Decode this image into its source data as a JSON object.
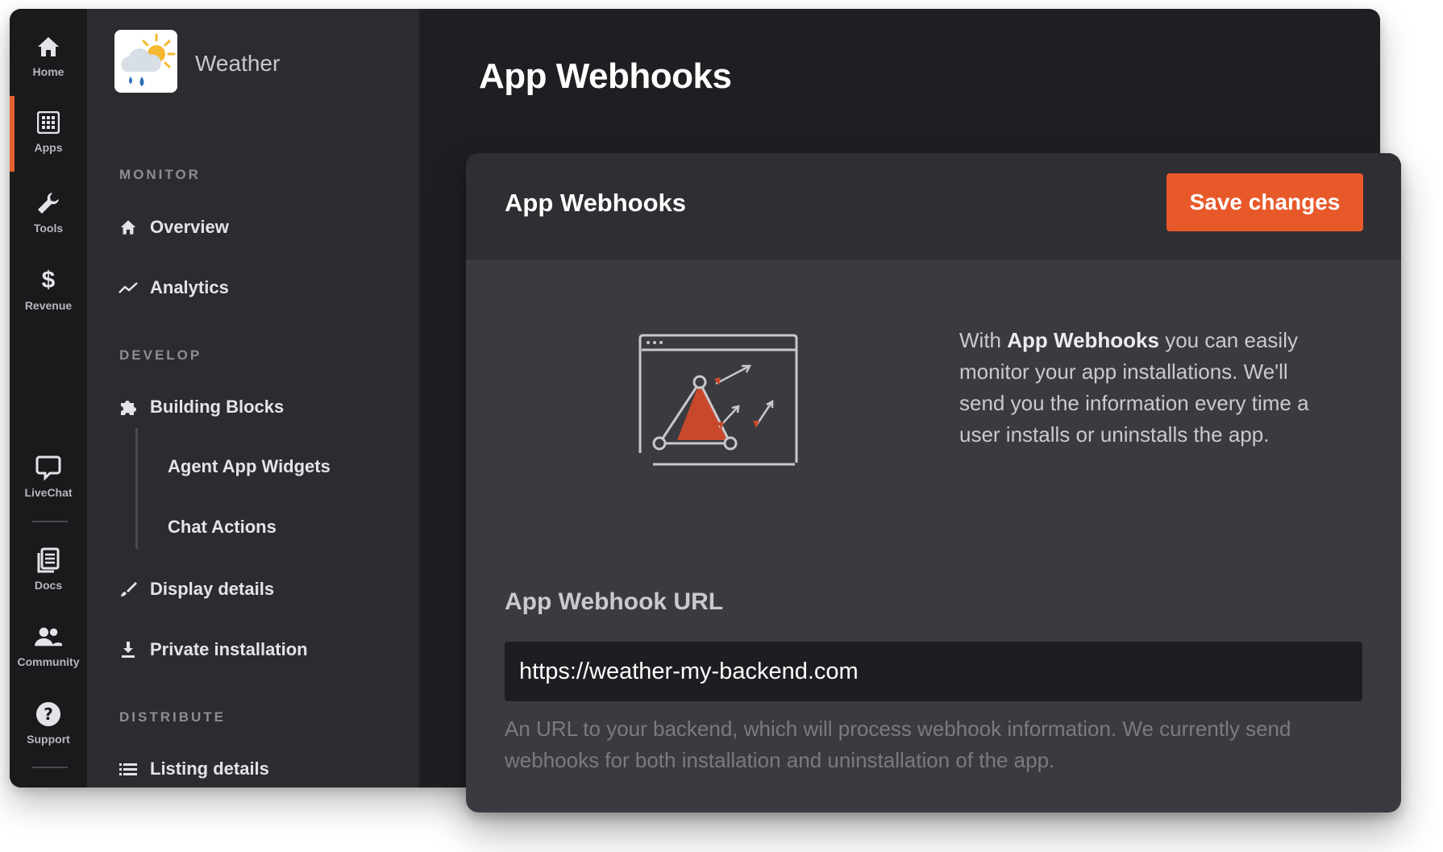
{
  "rail": {
    "items": [
      {
        "label": "Home",
        "icon": "home-icon"
      },
      {
        "label": "Apps",
        "icon": "apps-grid-icon"
      },
      {
        "label": "Tools",
        "icon": "wrench-icon"
      },
      {
        "label": "Revenue",
        "icon": "dollar-icon"
      },
      {
        "label": "LiveChat",
        "icon": "chat-bubble-icon"
      },
      {
        "label": "Docs",
        "icon": "docs-icon"
      },
      {
        "label": "Community",
        "icon": "community-icon"
      },
      {
        "label": "Support",
        "icon": "help-icon"
      }
    ],
    "active_color": "#e75f2b"
  },
  "app": {
    "name": "Weather"
  },
  "sidebar": {
    "monitor_label": "MONITOR",
    "overview": "Overview",
    "analytics": "Analytics",
    "develop_label": "DEVELOP",
    "building_blocks": "Building Blocks",
    "agent_app_widgets": "Agent App Widgets",
    "chat_actions": "Chat Actions",
    "display_details": "Display details",
    "private_installation": "Private installation",
    "distribute_label": "DISTRIBUTE",
    "listing_details": "Listing details"
  },
  "page": {
    "title": "App Webhooks"
  },
  "card": {
    "title": "App Webhooks",
    "save_label": "Save changes",
    "intro_prefix": "With ",
    "intro_bold": "App Webhooks",
    "intro_suffix": " you can easily monitor your app installations. We'll send you the information every time a user installs or uninstalls the app.",
    "field_label": "App Webhook URL",
    "url_value": "https://weather-my-backend.com",
    "help_text": "An URL to your backend, which will process webhook information. We currently send webhooks for both installation and uninstallation of the app."
  },
  "colors": {
    "accent": "#e8592a",
    "background": "#1f1f23",
    "card": "#3a3a40"
  }
}
